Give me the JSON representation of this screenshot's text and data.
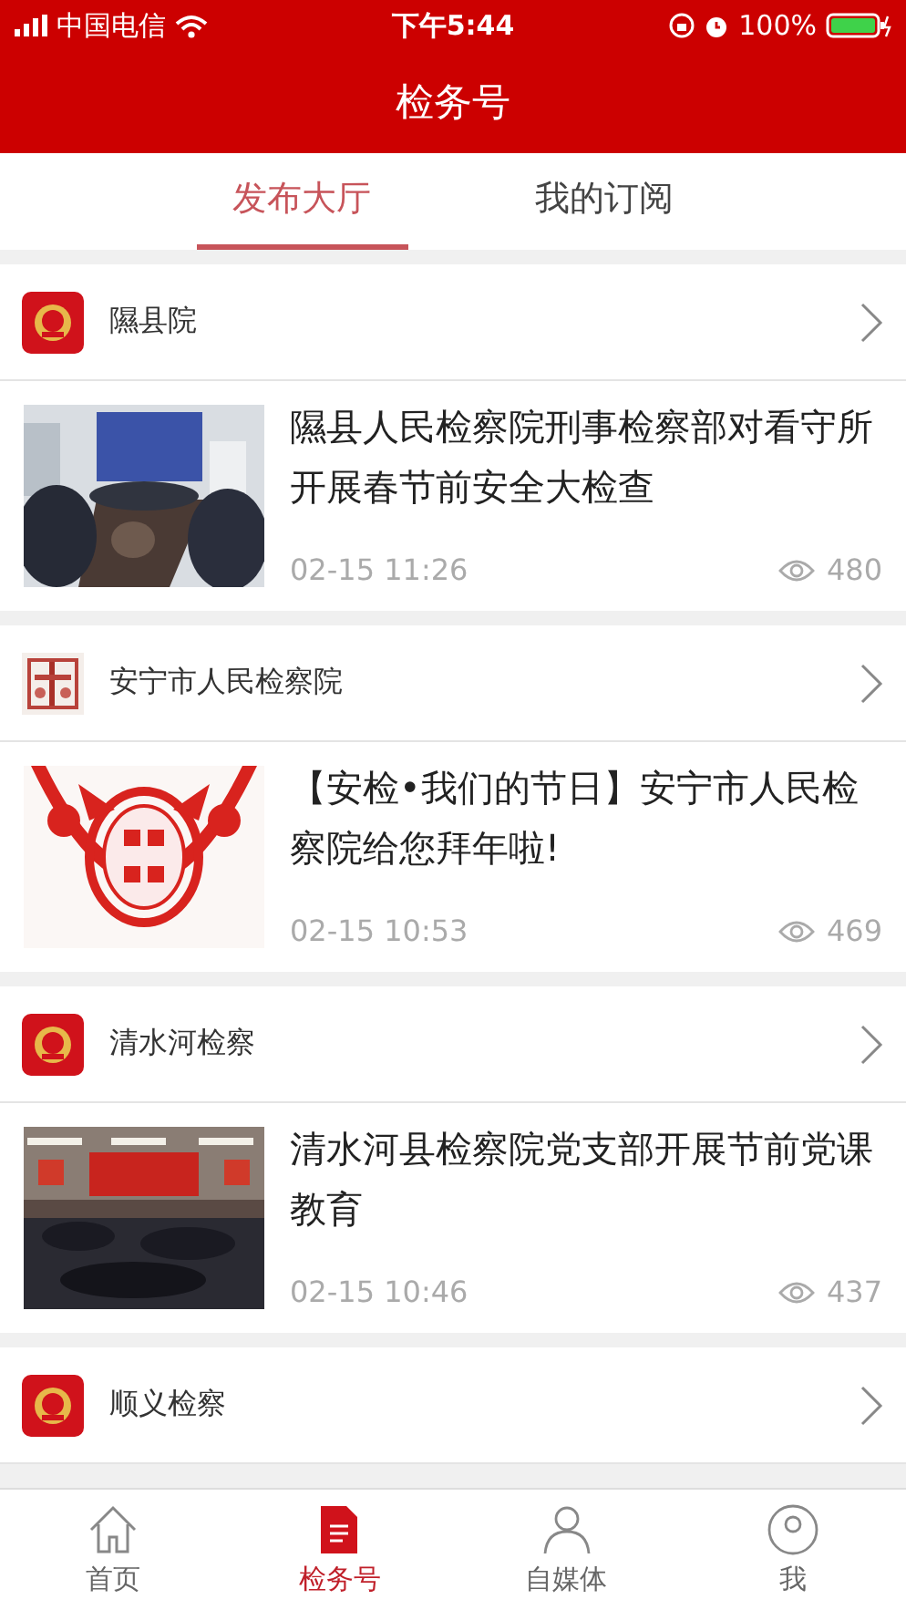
{
  "status_bar": {
    "carrier": "中国电信",
    "time": "下午5:44",
    "battery": "100%"
  },
  "nav_bar": {
    "title": "检务号"
  },
  "tabs": [
    {
      "label": "发布大厅",
      "selected": true
    },
    {
      "label": "我的订阅",
      "selected": false
    }
  ],
  "sections": [
    {
      "source": "隰县院",
      "article": {
        "title": "隰县人民检察院刑事检察部对看守所开展春节前安全大检查",
        "time": "02-15 11:26",
        "views": "480"
      }
    },
    {
      "source": "安宁市人民检察院",
      "article": {
        "title": "【安检•我们的节日】安宁市人民检察院给您拜年啦!",
        "time": "02-15 10:53",
        "views": "469"
      }
    },
    {
      "source": "清水河检察",
      "article": {
        "title": "清水河县检察院党支部开展节前党课教育",
        "time": "02-15 10:46",
        "views": "437"
      }
    },
    {
      "source": "顺义检察"
    }
  ],
  "bottom_tabs": [
    {
      "label": "首页",
      "selected": false
    },
    {
      "label": "检务号",
      "selected": true
    },
    {
      "label": "自媒体",
      "selected": false
    },
    {
      "label": "我",
      "selected": false
    }
  ]
}
